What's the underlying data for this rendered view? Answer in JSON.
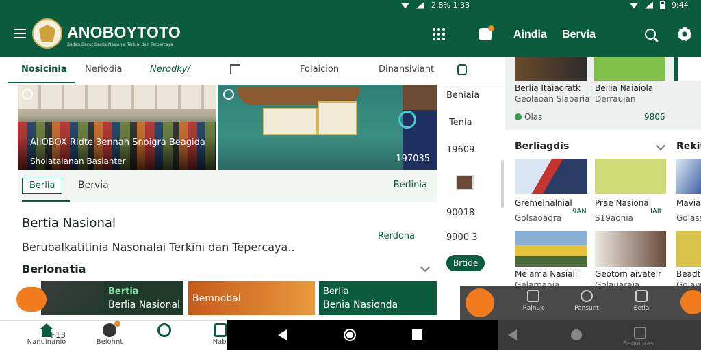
{
  "status_bar": {
    "left_time": "2.8% 1:33",
    "right_time": "9:44"
  },
  "app_bar": {
    "brand": "ANOBOYTOTO",
    "brand_sub": "Badan Bacot Berita Nasional Terkini dan Terpercaya"
  },
  "right_app_bar": {
    "title_a": "Aindia",
    "title_b": "Bervia"
  },
  "tabs": [
    "Nosicinia",
    "Neriodia",
    "Nerodky/",
    "Folaicion",
    "Dinansiviant"
  ],
  "hero": {
    "caption_left": "AIIOBOX Ridte 3ennah Snoigra Beagida",
    "caption_left2": "Sholataianan Basianter",
    "count_right": "197035"
  },
  "hero_bar": {
    "active_pill": "Berlia",
    "tab": "Bervia",
    "link": "Berlinia"
  },
  "side_strip": [
    "Beniaia",
    "Tenia",
    "19609",
    "90018",
    "9900 3"
  ],
  "section": {
    "title": "Bertia Nasional",
    "subtitle": "Berubalkatitinia Nasonalai Terkini dan Tepercaya..",
    "link": "Rerdona",
    "section2_title": "Berlonatia",
    "pill": "Brtide"
  },
  "cards": [
    {
      "t1": "",
      "t2": ""
    },
    {
      "t1": "Bertia",
      "t2": "Berlia Nasional"
    },
    {
      "t1": "",
      "t2": "Bemnobal"
    },
    {
      "t1": "Berlia",
      "t2": "Benia Nasionda"
    }
  ],
  "fab_small": "",
  "right_pane": {
    "top_cards": [
      {
        "title": "Berlia Itaiaoratk",
        "sub": "Geolaoan Slaoaria"
      },
      {
        "title": "Beilia Naiaiola",
        "sub": "Derrauian"
      }
    ],
    "top_meta": {
      "left": "Olas",
      "right": "9806"
    },
    "section_title": "Berliagdis",
    "section_title2": "Rekit",
    "grid": [
      {
        "title": "Gremelnalnial",
        "sub": "Golsaoadra",
        "tag": "9AN"
      },
      {
        "title": "Prae Nasional",
        "sub": "S19aonia",
        "tag": "IAIt"
      },
      {
        "title": "Mavia",
        "sub": "Golassoan"
      },
      {
        "title": "Meiama Nasiali",
        "sub": "Gelarnania"
      },
      {
        "title": "Geotom aivatelr",
        "sub": "Golauaraia"
      },
      {
        "title": "Beadtio",
        "sub": "Golawaoa"
      }
    ]
  },
  "overlay_nav": [
    "Rajnuk",
    "Pansunt",
    "Eetia"
  ],
  "bottom_nav": [
    {
      "label": "Nanuinanio",
      "value": "F13"
    },
    {
      "label": "Belohnt"
    },
    {
      "label": ""
    },
    {
      "label": "Nabi"
    }
  ],
  "right_sys_nav": [
    "Benoioras"
  ],
  "colors": {
    "primary": "#0b5b3e",
    "accent": "#f07c1d",
    "background": "#f5f6f5"
  }
}
